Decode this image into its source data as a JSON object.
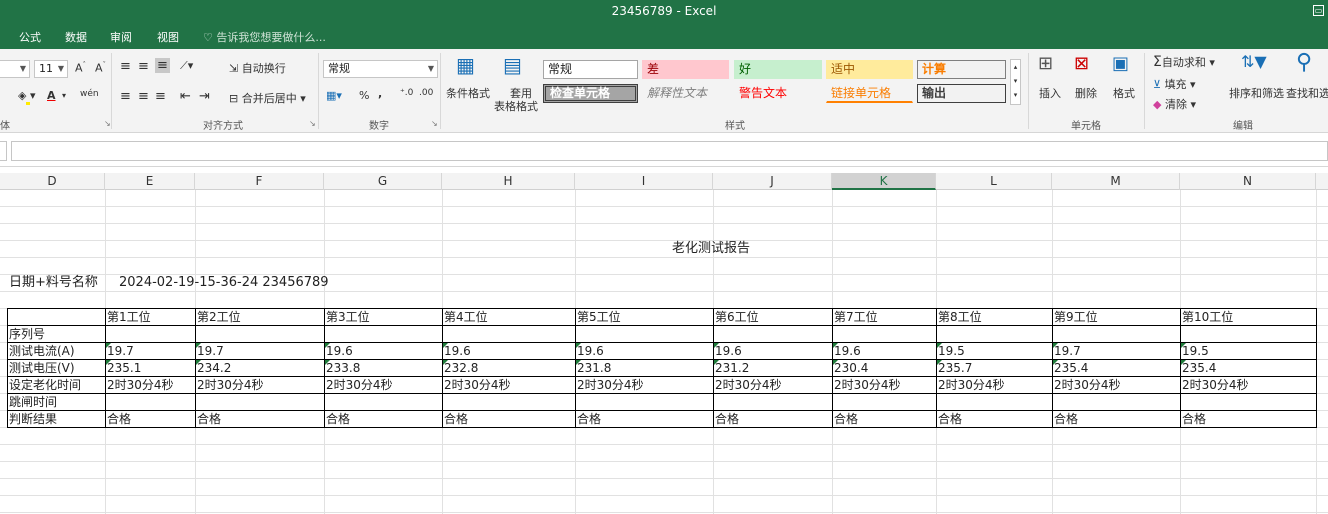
{
  "window": {
    "title": "23456789 - Excel"
  },
  "tabs": [
    {
      "label": "公式"
    },
    {
      "label": "数据"
    },
    {
      "label": "审阅"
    },
    {
      "label": "视图"
    }
  ],
  "tell_me": "告诉我您想要做什么...",
  "ribbon": {
    "font_size": "11",
    "font_group_label": "体",
    "wrap_text": "自动换行",
    "merge_center": "合并后居中",
    "align_group": "对齐方式",
    "number_format": "常规",
    "percent": "%",
    "comma": ",",
    "number_group": "数字",
    "conditional_format": "条件格式",
    "table_format_1": "套用",
    "table_format_2": "表格格式",
    "styles": {
      "normal": "常规",
      "bad": "差",
      "good": "好",
      "neutral": "适中",
      "calc": "计算",
      "check_cell": "检查单元格",
      "explanatory": "解释性文本",
      "warning": "警告文本",
      "linked_cell": "链接单元格",
      "output": "输出"
    },
    "styles_group": "样式",
    "insert": "插入",
    "delete": "删除",
    "format": "格式",
    "cells_group": "单元格",
    "autosum": "自动求和",
    "fill": "填充",
    "clear": "清除",
    "sort_filter": "排序和筛选",
    "find_select": "查找和选",
    "edit_group": "编辑"
  },
  "columns": [
    "D",
    "E",
    "F",
    "G",
    "H",
    "I",
    "J",
    "K",
    "L",
    "M",
    "N"
  ],
  "selected_column": "K",
  "sheet": {
    "title": "老化测试报告",
    "date_label": "日期+料号名称",
    "date_value": "2024-02-19-15-36-24 23456789",
    "stations": [
      "第1工位",
      "第2工位",
      "第3工位",
      "第4工位",
      "第5工位",
      "第6工位",
      "第7工位",
      "第8工位",
      "第9工位",
      "第10工位"
    ],
    "row_labels": [
      "序列号",
      "测试电流(A)",
      "测试电压(V)",
      "设定老化时间",
      "跳闸时间",
      "判断结果"
    ],
    "current": [
      "19.7",
      "19.7",
      "19.6",
      "19.6",
      "19.6",
      "19.6",
      "19.6",
      "19.5",
      "19.7",
      "19.5"
    ],
    "voltage": [
      "235.1",
      "234.2",
      "233.8",
      "232.8",
      "231.8",
      "231.2",
      "230.4",
      "235.7",
      "235.4",
      "235.4"
    ],
    "aging_time": [
      "2时30分4秒",
      "2时30分4秒",
      "2时30分4秒",
      "2时30分4秒",
      "2时30分4秒",
      "2时30分4秒",
      "2时30分4秒",
      "2时30分4秒",
      "2时30分4秒",
      "2时30分4秒"
    ],
    "result": [
      "合格",
      "合格",
      "合格",
      "合格",
      "合格",
      "合格",
      "合格",
      "合格",
      "合格",
      "合格"
    ]
  },
  "colors": {
    "accent": "#217346"
  }
}
